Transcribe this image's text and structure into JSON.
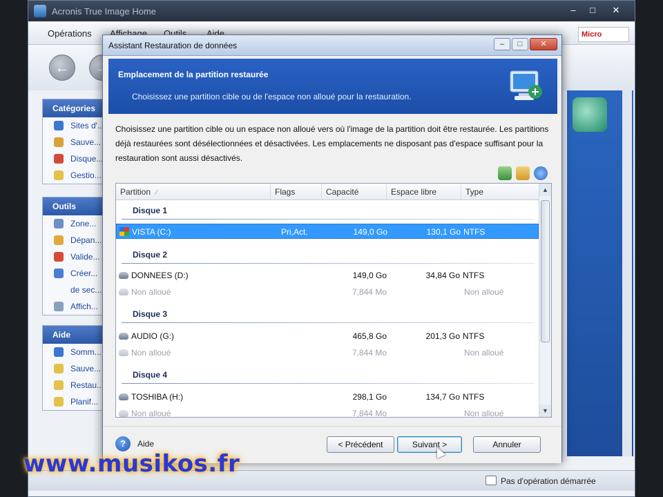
{
  "app": {
    "title": "Acronis True Image Home",
    "menu": [
      "Opérations",
      "Affichage",
      "Outils",
      "Aide"
    ],
    "brand": "Micro",
    "status": "Pas d'opération démarrée"
  },
  "sidebar": {
    "panels": [
      {
        "title": "Catégories",
        "items": [
          "Sites d'...",
          "Sauve...",
          "Disque...",
          "Gestio..."
        ]
      },
      {
        "title": "Outils",
        "items": [
          "Zone...",
          "Dépan...",
          "Valide...",
          "Créer...",
          "de sec...",
          "Affich..."
        ]
      },
      {
        "title": "Aide",
        "items": [
          "Somm...",
          "Sauve...",
          "Restau...",
          "Planif..."
        ]
      }
    ]
  },
  "dialog": {
    "title": "Assistant Restauration de données",
    "heading": "Emplacement de la partition restaurée",
    "subheading": "Choisissez une partition cible ou de l'espace non alloué pour la restauration.",
    "description": "Choisissez une partition cible ou un espace non alloué vers où l'image de la partition doit être restaurée. Les partitions déjà restaurées sont désélectionnées et désactivées. Les emplacements ne disposant pas d'espace suffisant pour la restauration sont aussi désactivés.",
    "columns": [
      "Partition",
      "Flags",
      "Capacité",
      "Espace libre",
      "Type"
    ],
    "groups": [
      {
        "label": "Disque 1",
        "rows": [
          {
            "name": "VISTA (C:)",
            "flags": "Pri,Act.",
            "capacity": "149,0 Go",
            "free": "130,1 Go",
            "type": "NTFS",
            "selected": true,
            "disabled": false,
            "icon": "windows-icon"
          }
        ]
      },
      {
        "label": "Disque 2",
        "rows": [
          {
            "name": "DONNEES (D:)",
            "flags": "",
            "capacity": "149,0 Go",
            "free": "34,84 Go",
            "type": "NTFS",
            "selected": false,
            "disabled": false,
            "icon": "disk-icon"
          },
          {
            "name": "Non alloué",
            "flags": "",
            "capacity": "7,844 Mo",
            "free": "",
            "type": "Non alloué",
            "selected": false,
            "disabled": true,
            "icon": "disk-icon"
          }
        ]
      },
      {
        "label": "Disque 3",
        "rows": [
          {
            "name": "AUDIO (G:)",
            "flags": "",
            "capacity": "465,8 Go",
            "free": "201,3 Go",
            "type": "NTFS",
            "selected": false,
            "disabled": false,
            "icon": "disk-icon"
          },
          {
            "name": "Non alloué",
            "flags": "",
            "capacity": "7,844 Mo",
            "free": "",
            "type": "Non alloué",
            "selected": false,
            "disabled": true,
            "icon": "disk-icon"
          }
        ]
      },
      {
        "label": "Disque 4",
        "rows": [
          {
            "name": "TOSHIBA (H:)",
            "flags": "",
            "capacity": "298,1 Go",
            "free": "134,7 Go",
            "type": "NTFS",
            "selected": false,
            "disabled": false,
            "icon": "disk-icon"
          },
          {
            "name": "Non alloué",
            "flags": "",
            "capacity": "7,844 Mo",
            "free": "",
            "type": "Non alloué",
            "selected": false,
            "disabled": true,
            "icon": "disk-icon"
          }
        ]
      }
    ],
    "help_label": "Aide",
    "buttons": {
      "previous": "< Précédent",
      "next": "Suivant >",
      "cancel": "Annuler"
    }
  },
  "watermark": "www.musikos.fr",
  "colors": {
    "selection": "#3399ff",
    "header_blue": "#1b4ea8",
    "watermark": "#2a38d8"
  }
}
